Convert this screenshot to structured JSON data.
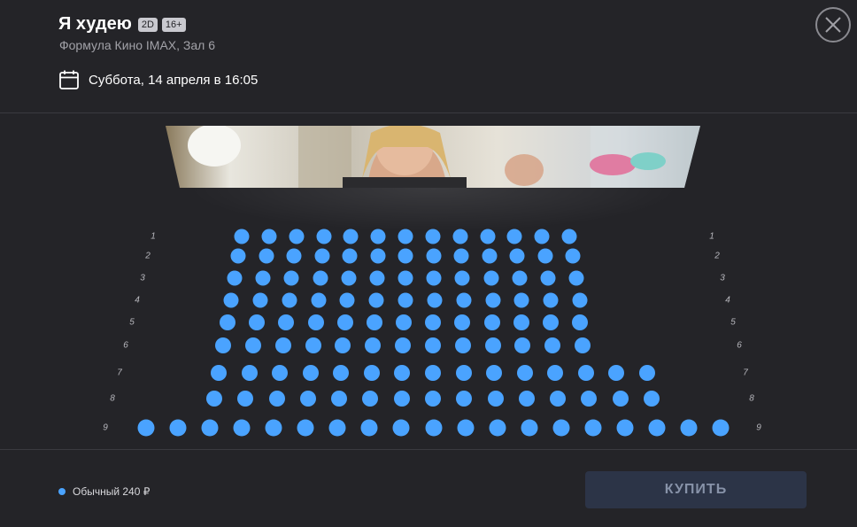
{
  "header": {
    "title": "Я худею",
    "badges": [
      "2D",
      "16+"
    ],
    "subtitle": "Формула Кино IMAX, Зал 6",
    "date": "Суббота, 14 апреля в 16:05"
  },
  "screen": {
    "image": "movie-still"
  },
  "hall": {
    "rows": [
      {
        "label": "1",
        "seats": 13
      },
      {
        "label": "2",
        "seats": 13
      },
      {
        "label": "3",
        "seats": 13
      },
      {
        "label": "4",
        "seats": 13
      },
      {
        "label": "5",
        "seats": 13
      },
      {
        "label": "6",
        "seats": 13
      },
      {
        "label": "7",
        "seats": 15
      },
      {
        "label": "8",
        "seats": 15
      },
      {
        "label": "9",
        "seats": 19
      }
    ],
    "seat_color": "#4aa3ff"
  },
  "legend": {
    "label": "Обычный 240 ₽",
    "color": "#4aa3ff"
  },
  "buy_button": "КУПИТЬ",
  "colors": {
    "background": "#242428",
    "accent": "#4aa3ff"
  }
}
